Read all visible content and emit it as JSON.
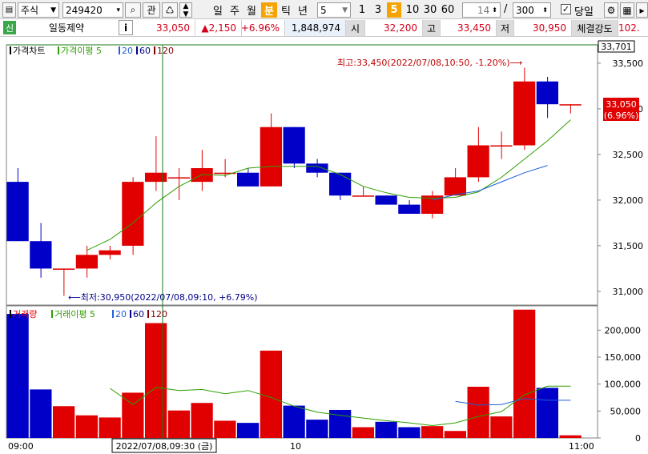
{
  "toolbar": {
    "market": "주식",
    "code": "249420",
    "watch_label": "관",
    "periods": [
      "일",
      "주",
      "월",
      "분",
      "틱",
      "년"
    ],
    "selected_period": "분",
    "interval": "5",
    "minute_buttons": [
      "1",
      "3",
      "5",
      "10",
      "30",
      "60"
    ],
    "selected_minute": "5",
    "count_shown": "14",
    "count_total": "300",
    "sep": "/",
    "today_label": "당일"
  },
  "quote": {
    "badge": "신",
    "name": "일동제약",
    "info_btn": "i",
    "price": "33,050",
    "change": "▲2,150",
    "change_pct": "+6.96%",
    "volume": "1,848,974",
    "open_label": "시",
    "open": "32,200",
    "high_label": "고",
    "high": "33,450",
    "low_label": "저",
    "low": "30,950",
    "strength_label": "체결강도",
    "strength": "102."
  },
  "colors": {
    "up": "#e00000",
    "down": "#0000c8",
    "ma5": "#2e9e00",
    "ma20": "#1f5fd6",
    "ma60": "#00008b",
    "ma120": "#800000",
    "cursor": "#1a7a1a"
  },
  "legend": {
    "price": {
      "title": "가격차트",
      "ma": "가격이평",
      "p5": "5",
      "p20": "20",
      "p60": "60",
      "p120": "120"
    },
    "volume": {
      "title": "거래량",
      "ma": "거래이평",
      "p5": "5",
      "p20": "20",
      "p60": "60",
      "p120": "120"
    }
  },
  "annotations": {
    "high": "최고:33,450(2022/07/08,10:50, -1.20%)⟶",
    "low": "⟵최저:30,950(2022/07/08,09:10, +6.79%)",
    "cursor_y": "33,701",
    "last_price": "33,050",
    "last_pct": "(6.96%)",
    "cursor_time": "2022/07/08,09:30 (금)"
  },
  "chart_data": [
    {
      "type": "candlestick",
      "title": "가격차트",
      "ylim": [
        30850,
        33701
      ],
      "yticks": [
        31000,
        31500,
        32000,
        32500,
        33000,
        33500
      ],
      "ytick_labels": [
        "31,000",
        "31,500",
        "32,000",
        "32,500",
        "33,000",
        "33,500"
      ],
      "candles": [
        {
          "o": 32200,
          "h": 32350,
          "l": 31550,
          "c": 31550
        },
        {
          "o": 31550,
          "h": 31750,
          "l": 31150,
          "c": 31250
        },
        {
          "o": 31250,
          "h": 31250,
          "l": 30950,
          "c": 31250
        },
        {
          "o": 31250,
          "h": 31500,
          "l": 31150,
          "c": 31400
        },
        {
          "o": 31400,
          "h": 31500,
          "l": 31350,
          "c": 31450
        },
        {
          "o": 31500,
          "h": 32250,
          "l": 31400,
          "c": 32200
        },
        {
          "o": 32200,
          "h": 32700,
          "l": 32100,
          "c": 32300
        },
        {
          "o": 32250,
          "h": 32350,
          "l": 32000,
          "c": 32250
        },
        {
          "o": 32200,
          "h": 32550,
          "l": 32100,
          "c": 32350
        },
        {
          "o": 32300,
          "h": 32450,
          "l": 32250,
          "c": 32300
        },
        {
          "o": 32300,
          "h": 32350,
          "l": 32150,
          "c": 32150
        },
        {
          "o": 32150,
          "h": 32950,
          "l": 32150,
          "c": 32800
        },
        {
          "o": 32800,
          "h": 32800,
          "l": 32350,
          "c": 32400
        },
        {
          "o": 32400,
          "h": 32450,
          "l": 32250,
          "c": 32300
        },
        {
          "o": 32300,
          "h": 32300,
          "l": 32000,
          "c": 32050
        },
        {
          "o": 32050,
          "h": 32150,
          "l": 32050,
          "c": 32050
        },
        {
          "o": 32050,
          "h": 32050,
          "l": 31950,
          "c": 31950
        },
        {
          "o": 31950,
          "h": 32000,
          "l": 31850,
          "c": 31850
        },
        {
          "o": 31850,
          "h": 32100,
          "l": 31800,
          "c": 32050
        },
        {
          "o": 32050,
          "h": 32350,
          "l": 32050,
          "c": 32250
        },
        {
          "o": 32250,
          "h": 32800,
          "l": 32200,
          "c": 32600
        },
        {
          "o": 32600,
          "h": 32750,
          "l": 32450,
          "c": 32600
        },
        {
          "o": 32600,
          "h": 33450,
          "l": 32550,
          "c": 33300
        },
        {
          "o": 33300,
          "h": 33350,
          "l": 32900,
          "c": 33050
        },
        {
          "o": 33050,
          "h": 33050,
          "l": 32950,
          "c": 33050
        }
      ],
      "ma5": [
        null,
        null,
        null,
        null,
        31450,
        31570,
        31750,
        31970,
        32150,
        32280,
        32270,
        32350,
        32370,
        32370,
        32370,
        32280,
        32150,
        32080,
        32030,
        32020,
        32030,
        32090,
        32250,
        32450,
        32650,
        32880
      ],
      "ma20": [
        null,
        null,
        null,
        null,
        null,
        null,
        null,
        null,
        null,
        null,
        null,
        null,
        null,
        null,
        null,
        null,
        null,
        null,
        null,
        32000,
        32060,
        32100,
        32200,
        32300,
        32380
      ]
    },
    {
      "type": "bar",
      "title": "거래량",
      "ylim": [
        0,
        245000
      ],
      "yticks": [
        0,
        50000,
        100000,
        150000,
        200000
      ],
      "ytick_labels": [
        "0",
        "50,000",
        "100,000",
        "150,000",
        "200,000"
      ],
      "volume": [
        230000,
        90000,
        59000,
        42000,
        38000,
        84000,
        213000,
        51000,
        65000,
        32000,
        28000,
        162000,
        60000,
        34000,
        52000,
        20000,
        30000,
        20000,
        22000,
        13000,
        95000,
        40000,
        238000,
        93000,
        5000
      ],
      "ma5": [
        null,
        null,
        null,
        null,
        null,
        92000,
        62000,
        94000,
        88000,
        90000,
        82000,
        88000,
        75000,
        59000,
        48000,
        42000,
        37000,
        32000,
        28000,
        23000,
        28000,
        40000,
        49000,
        80000,
        96000,
        96000
      ],
      "ma20": [
        null,
        null,
        null,
        null,
        null,
        null,
        null,
        null,
        null,
        null,
        null,
        null,
        null,
        null,
        null,
        null,
        null,
        null,
        null,
        null,
        68000,
        61000,
        62000,
        73000,
        70000,
        70000
      ]
    },
    {
      "type": "axis",
      "xtick_labels": [
        "09:00",
        "10",
        "11:00"
      ]
    }
  ]
}
